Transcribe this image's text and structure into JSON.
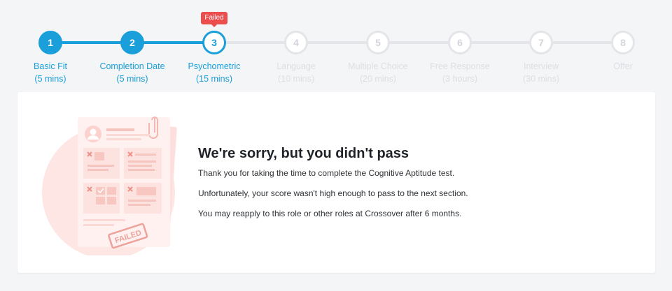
{
  "stepper": {
    "failed_badge": "Failed",
    "steps": [
      {
        "number": "1",
        "label": "Basic Fit",
        "duration": "(5 mins)",
        "status": "done"
      },
      {
        "number": "2",
        "label": "Completion Date",
        "duration": "(5 mins)",
        "status": "done"
      },
      {
        "number": "3",
        "label": "Psychometric",
        "duration": "(15 mins)",
        "status": "current"
      },
      {
        "number": "4",
        "label": "Language",
        "duration": "(10 mins)",
        "status": "pending"
      },
      {
        "number": "5",
        "label": "Multiple Choice",
        "duration": "(20 mins)",
        "status": "pending"
      },
      {
        "number": "6",
        "label": "Free Response",
        "duration": "(3 hours)",
        "status": "pending"
      },
      {
        "number": "7",
        "label": "Interview",
        "duration": "(30 mins)",
        "status": "pending"
      },
      {
        "number": "8",
        "label": "Offer",
        "duration": "",
        "status": "pending"
      }
    ]
  },
  "result": {
    "heading": "We're sorry, but you didn't pass",
    "line1": "Thank you for taking the time to complete the Cognitive Aptitude test.",
    "line2": "Unfortunately, your score wasn't high enough to pass to the next section.",
    "line3": "You may reapply to this role or other roles at Crossover after 6 months.",
    "stamp_text": "FAILED"
  },
  "colors": {
    "accent": "#1a9fdb",
    "failed": "#ec4d4d",
    "pending": "#e3e5e8",
    "background": "#f4f5f7",
    "illustration_pink": "#fde6e4"
  }
}
